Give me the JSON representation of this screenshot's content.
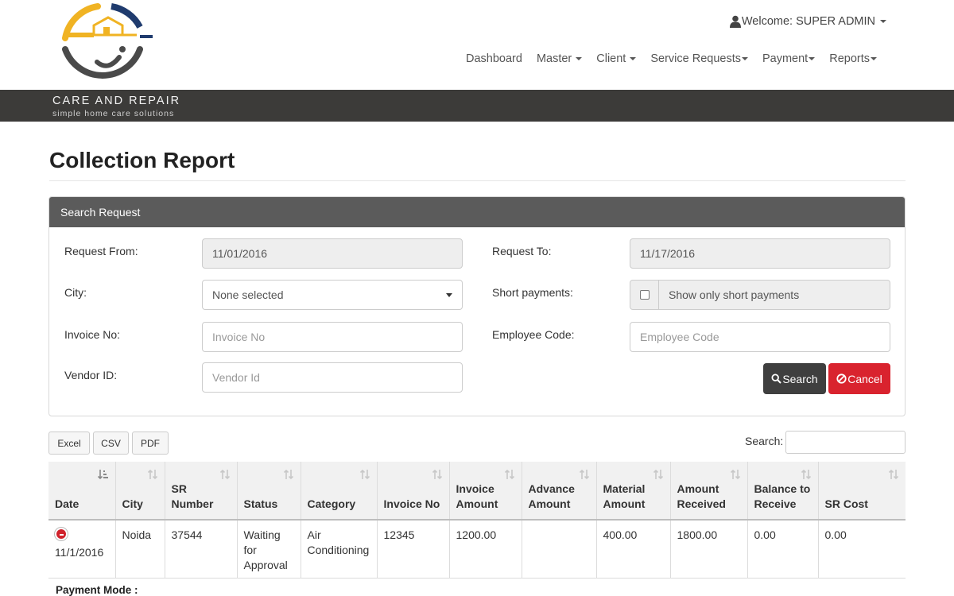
{
  "brand": {
    "title": "CARE AND REPAIR",
    "tagline": "simple home care solutions",
    "colors": {
      "accent_yellow": "#f0b323",
      "accent_navy": "#1f3b6e",
      "accent_gray": "#4a4a4a",
      "bar": "#3c3b39"
    }
  },
  "header": {
    "welcome": "Welcome: SUPER ADMIN",
    "user_icon": "user-icon",
    "nav": [
      {
        "label": "Dashboard",
        "dropdown": false
      },
      {
        "label": "Master",
        "dropdown": true
      },
      {
        "label": "Client",
        "dropdown": true
      },
      {
        "label": "Service Requests",
        "dropdown": true
      },
      {
        "label": "Payment",
        "dropdown": true
      },
      {
        "label": "Reports",
        "dropdown": true
      }
    ]
  },
  "page": {
    "title": "Collection Report"
  },
  "search_panel": {
    "title": "Search Request",
    "request_from_label": "Request From:",
    "request_from_value": "11/01/2016",
    "request_to_label": "Request To:",
    "request_to_value": "11/17/2016",
    "city_label": "City:",
    "city_value": "None selected",
    "short_payments_label": "Short payments:",
    "short_payments_text": "Show only short payments",
    "short_payments_checked": false,
    "invoice_no_label": "Invoice No:",
    "invoice_no_placeholder": "Invoice No",
    "employee_code_label": "Employee Code:",
    "employee_code_placeholder": "Employee Code",
    "vendor_id_label": "Vendor ID:",
    "vendor_id_placeholder": "Vendor Id",
    "search_button": "Search",
    "cancel_button": "Cancel",
    "colors": {
      "search": "#3f3f3f",
      "cancel": "#d9232e",
      "panel_head": "#5b5b5b"
    }
  },
  "export": {
    "excel": "Excel",
    "csv": "CSV",
    "pdf": "PDF",
    "search_label": "Search:"
  },
  "table": {
    "columns": [
      "Date",
      "City",
      "SR Number",
      "Status",
      "Category",
      "Invoice No",
      "Invoice Amount",
      "Advance Amount",
      "Material Amount",
      "Amount Received",
      "Balance to Receive",
      "SR Cost"
    ],
    "rows": [
      {
        "date": "11/1/2016",
        "city": "Noida",
        "sr_number": "37544",
        "status": "Waiting for Approval",
        "category": "Air Conditioning",
        "invoice_no": "12345",
        "invoice_amount": "1200.00",
        "advance_amount": "",
        "material_amount": "400.00",
        "amount_received": "1800.00",
        "balance_to_receive": "0.00",
        "sr_cost": "0.00"
      }
    ],
    "child_label": "Payment Mode :"
  }
}
